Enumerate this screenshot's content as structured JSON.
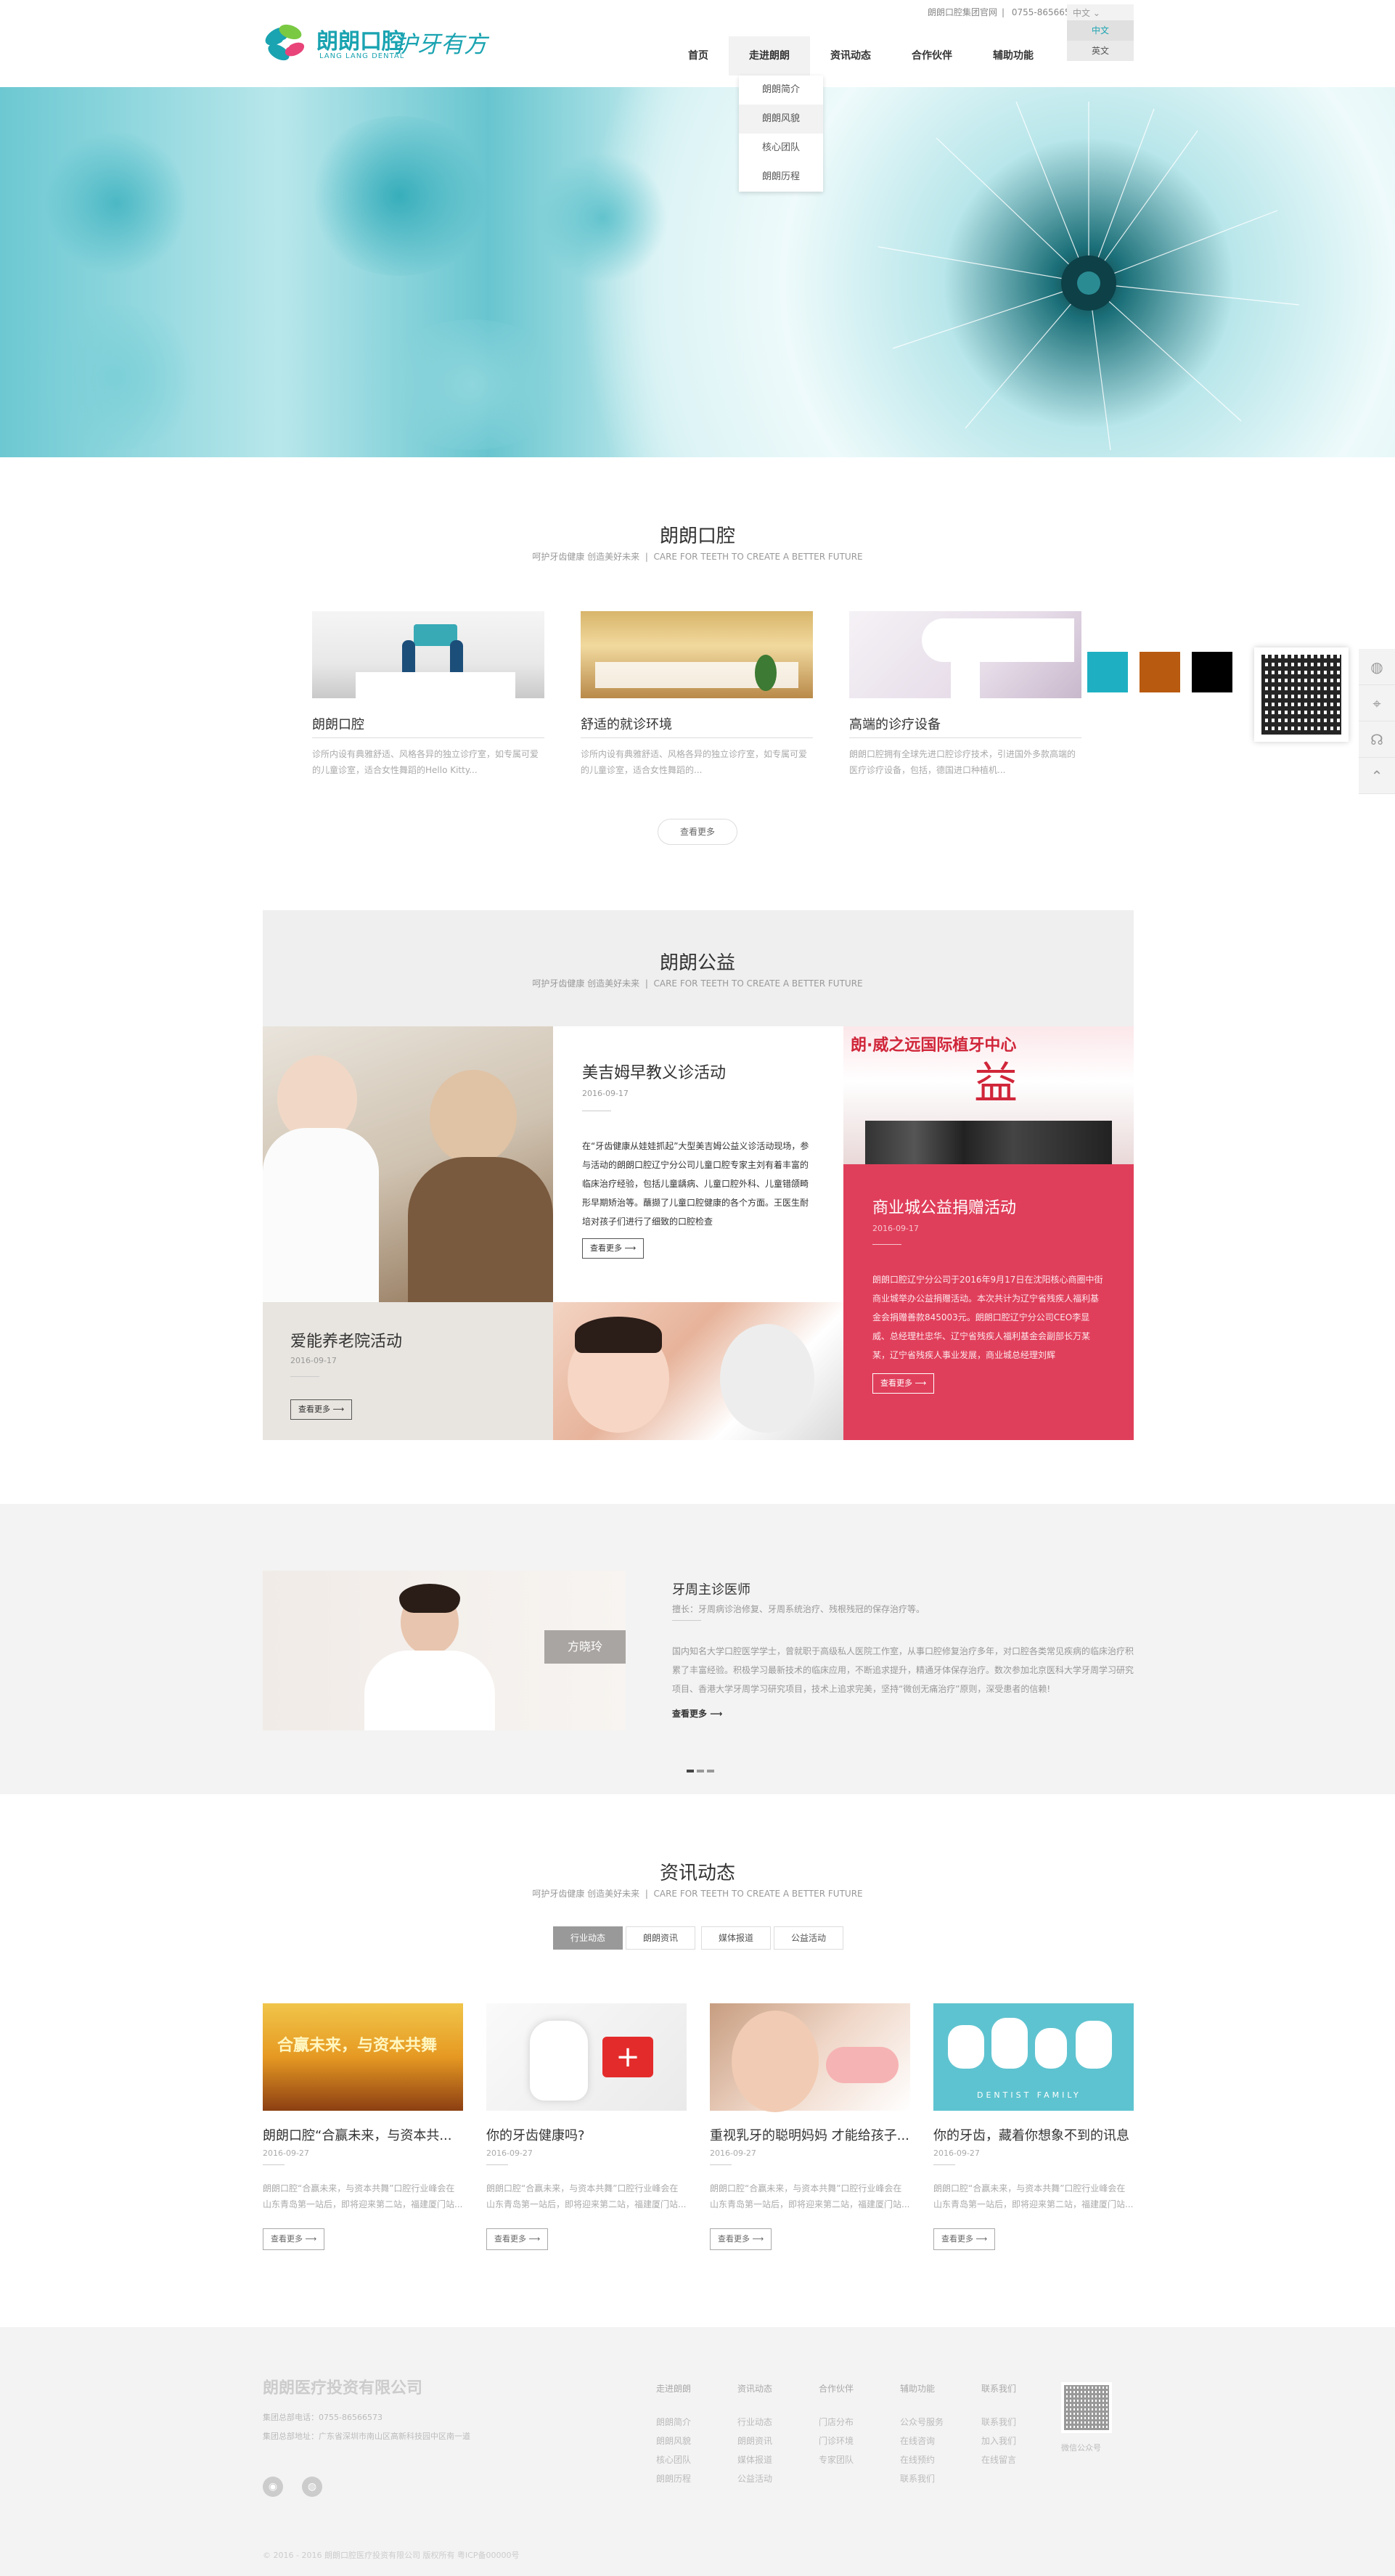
{
  "header": {
    "logo_text": "朗朗口腔",
    "logo_sub": "LANG LANG DENTAL",
    "slogan": "护牙有方",
    "toplinks": [
      "朗朗口腔集团官网",
      "0755-86566573"
    ],
    "lang_current": "中文",
    "lang_options": [
      "中文",
      "英文"
    ],
    "nav": [
      "首页",
      "走进朗朗",
      "资讯动态",
      "合作伙伴",
      "辅助功能"
    ],
    "dropdown": [
      "朗朗简介",
      "朗朗风貌",
      "核心团队",
      "朗朗历程"
    ]
  },
  "about": {
    "title": "朗朗口腔",
    "subtitle_cn": "呵护牙齿健康  创造美好未来",
    "subtitle_en": "CARE FOR TEETH TO CREATE A BETTER FUTURE",
    "cards": [
      {
        "title": "朗朗口腔",
        "desc": "诊所内设有典雅舒适、风格各异的独立诊疗室，如专属可爱的儿童诊室，适合女性舞蹈的Hello Kitty..."
      },
      {
        "title": "舒适的就诊环境",
        "desc": "诊所内设有典雅舒适、风格各异的独立诊疗室，如专属可爱的儿童诊室，适合女性舞蹈的..."
      },
      {
        "title": "高端的诊疗设备",
        "desc": "朗朗口腔拥有全球先进口腔诊疗技术，引进国外多款高端的医疗诊疗设备，包括，德国进口种植机..."
      }
    ],
    "more": "查看更多",
    "swatch_colors": [
      "#1eb0c2",
      "#b85a10",
      "#000000"
    ]
  },
  "welfare": {
    "title": "朗朗公益",
    "subtitle_cn": "呵护牙齿健康  创造美好未来",
    "subtitle_en": "CARE FOR TEETH TO CREATE A BETTER FUTURE",
    "item1": {
      "title": "美吉姆早教义诊活动",
      "date": "2016-09-17",
      "text": "在“牙齿健康从娃娃抓起”大型美吉姆公益义诊活动现场，参与活动的朗朗口腔辽宁分公司儿童口腔专家主刘有着丰富的临床治疗经验，包括儿童龋病、儿童口腔外科、儿童错颌畸形早期矫治等。蘸撷了儿童口腔健康的各个方面。王医生耐培对孩子们进行了细致的口腔检查",
      "btn": "查看更多"
    },
    "item2": {
      "title": "爱能养老院活动",
      "date": "2016-09-17",
      "btn": "查看更多"
    },
    "item3": {
      "title": "商业城公益捐赠活动",
      "date": "2016-09-17",
      "text": "朗朗口腔辽宁分公司于2016年9月17日在沈阳核心商圈中街商业城举办公益捐赠活动。本次共计为辽宁省残疾人福利基金会捐赠善款845003元。朗朗口腔辽宁分公司CEO李显威、总经理杜忠华、辽宁省残疾人福利基金会副部长万某某，辽宁省残疾人事业发展，商业城总经理刘辉",
      "btn": "查看更多"
    },
    "banner_text": "朗·威之远国际植牙中心"
  },
  "doctor": {
    "name": "方晓玲",
    "role": "牙周主诊医师",
    "specialty": "擅长：牙周病诊治修复、牙周系统治疗、残根残冠的保存治疗等。",
    "desc": "国内知名大学口腔医学学士，曾就职于高级私人医院工作室，从事口腔修复治疗多年，对口腔各类常见疾病的临床治疗积累了丰富经验。积极学习最新技术的临床应用，不断追求提升，精通牙体保存治疗。数次参加北京医科大学牙周学习研究项目、香港大学牙周学习研究项目，技术上追求完美，坚持“微创无痛治疗”原则，深受患者的信赖!",
    "more": "查看更多"
  },
  "news": {
    "title": "资讯动态",
    "subtitle_cn": "呵护牙齿健康  创造美好未来",
    "subtitle_en": "CARE FOR TEETH TO CREATE A BETTER FUTURE",
    "tabs": [
      "行业动态",
      "朗朗资讯",
      "媒体报道",
      "公益活动"
    ],
    "items": [
      {
        "title": "朗朗口腔“合赢未来，与资本共...",
        "date": "2016-09-27",
        "desc": "朗朗口腔“合赢未来，与资本共舞”口腔行业峰会在山东青岛第一站后，即将迎来第二站，福建厦门站...",
        "btn": "查看更多",
        "img_text": "合赢未来，与资本共舞"
      },
      {
        "title": "你的牙齿健康吗?",
        "date": "2016-09-27",
        "desc": "朗朗口腔“合赢未来，与资本共舞”口腔行业峰会在山东青岛第一站后，即将迎来第二站，福建厦门站...",
        "btn": "查看更多"
      },
      {
        "title": "重视乳牙的聪明妈妈 才能给孩子...",
        "date": "2016-09-27",
        "desc": "朗朗口腔“合赢未来，与资本共舞”口腔行业峰会在山东青岛第一站后，即将迎来第二站，福建厦门站...",
        "btn": "查看更多"
      },
      {
        "title": "你的牙齿，藏着你想象不到的讯息",
        "date": "2016-09-27",
        "desc": "朗朗口腔“合赢未来，与资本共舞”口腔行业峰会在山东青岛第一站后，即将迎来第二站，福建厦门站...",
        "btn": "查看更多",
        "img_text": "DENTIST FAMILY"
      }
    ]
  },
  "footer": {
    "company": "朗朗医疗投资有限公司",
    "phone": "集团总部电话：0755-86566573",
    "address": "集团总部地址：广东省深圳市南山区高新科技园中区南一道",
    "cols": [
      {
        "head": "走进朗朗",
        "links": [
          "朗朗简介",
          "朗朗风貌",
          "核心团队",
          "朗朗历程"
        ]
      },
      {
        "head": "资讯动态",
        "links": [
          "行业动态",
          "朗朗资讯",
          "媒体报道",
          "公益活动"
        ]
      },
      {
        "head": "合作伙伴",
        "links": [
          "门店分布",
          "门诊环境",
          "专家团队"
        ]
      },
      {
        "head": "辅助功能",
        "links": [
          "公众号服务",
          "在线咨询",
          "在线预约",
          "联系我们"
        ]
      },
      {
        "head": "联系我们",
        "links": [
          "联系我们",
          "加入我们",
          "在线留言"
        ]
      }
    ],
    "qr_label": "微信公众号",
    "copyright": "© 2016 - 2016 朗朗口腔医疗投资有限公司 版权所有 粤ICP备00000号"
  }
}
